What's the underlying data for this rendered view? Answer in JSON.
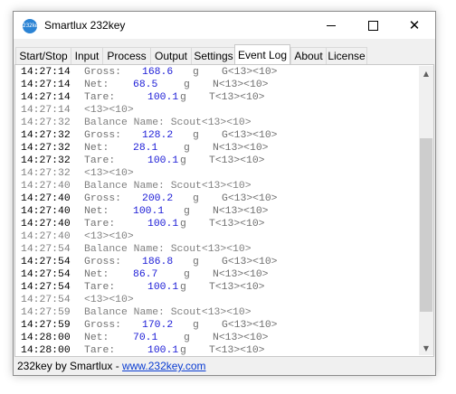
{
  "window": {
    "title": "Smartlux 232key",
    "icon_text": "232key",
    "buttons": [
      "minimize-icon",
      "maximize-icon",
      "close-icon"
    ]
  },
  "tabs": [
    {
      "label": "Start/Stop"
    },
    {
      "label": "Input"
    },
    {
      "label": "Process"
    },
    {
      "label": "Output"
    },
    {
      "label": "Settings"
    },
    {
      "label": "Event Log",
      "active": true
    },
    {
      "label": "About"
    },
    {
      "label": "License"
    }
  ],
  "log": [
    {
      "time": "14:27:14",
      "label": "Gross:",
      "value": "168.6",
      "unit": "g",
      "code": "G<13><10>"
    },
    {
      "time": "14:27:14",
      "label": "Net:",
      "value": "68.5",
      "unit": "g",
      "code": "N<13><10>"
    },
    {
      "time": "14:27:14",
      "label": "Tare:",
      "value": "100.1",
      "unit": "g",
      "code": "T<13><10>"
    },
    {
      "time": "14:27:14",
      "label": "<13><10>",
      "dim": true
    },
    {
      "time": "14:27:32",
      "label": "Balance Name: Scout<13><10>",
      "dim": true
    },
    {
      "time": "14:27:32",
      "label": "Gross:",
      "value": "128.2",
      "unit": "g",
      "code": "G<13><10>"
    },
    {
      "time": "14:27:32",
      "label": "Net:",
      "value": "28.1",
      "unit": "g",
      "code": "N<13><10>"
    },
    {
      "time": "14:27:32",
      "label": "Tare:",
      "value": "100.1",
      "unit": "g",
      "code": "T<13><10>"
    },
    {
      "time": "14:27:32",
      "label": "<13><10>",
      "dim": true
    },
    {
      "time": "14:27:40",
      "label": "Balance Name: Scout<13><10>",
      "dim": true
    },
    {
      "time": "14:27:40",
      "label": "Gross:",
      "value": "200.2",
      "unit": "g",
      "code": "G<13><10>"
    },
    {
      "time": "14:27:40",
      "label": "Net:",
      "value": "100.1",
      "unit": "g",
      "code": "N<13><10>"
    },
    {
      "time": "14:27:40",
      "label": "Tare:",
      "value": "100.1",
      "unit": "g",
      "code": "T<13><10>"
    },
    {
      "time": "14:27:40",
      "label": "<13><10>",
      "dim": true
    },
    {
      "time": "14:27:54",
      "label": "Balance Name: Scout<13><10>",
      "dim": true
    },
    {
      "time": "14:27:54",
      "label": "Gross:",
      "value": "186.8",
      "unit": "g",
      "code": "G<13><10>"
    },
    {
      "time": "14:27:54",
      "label": "Net:",
      "value": "86.7",
      "unit": "g",
      "code": "N<13><10>"
    },
    {
      "time": "14:27:54",
      "label": "Tare:",
      "value": "100.1",
      "unit": "g",
      "code": "T<13><10>"
    },
    {
      "time": "14:27:54",
      "label": "<13><10>",
      "dim": true
    },
    {
      "time": "14:27:59",
      "label": "Balance Name: Scout<13><10>",
      "dim": true
    },
    {
      "time": "14:27:59",
      "label": "Gross:",
      "value": "170.2",
      "unit": "g",
      "code": "G<13><10>"
    },
    {
      "time": "14:28:00",
      "label": "Net:",
      "value": "70.1",
      "unit": "g",
      "code": "N<13><10>"
    },
    {
      "time": "14:28:00",
      "label": "Tare:",
      "value": "100.1",
      "unit": "g",
      "code": "T<13><10>"
    }
  ],
  "scrollbar": {
    "up": "scroll-up-arrow-icon",
    "down": "scroll-down-arrow-icon"
  },
  "status": {
    "text": "232key by Smartlux - ",
    "link": "www.232key.com"
  },
  "colors": {
    "value_text": "#1a1ad6",
    "label_text": "#707070",
    "link": "#0a3cd2"
  }
}
